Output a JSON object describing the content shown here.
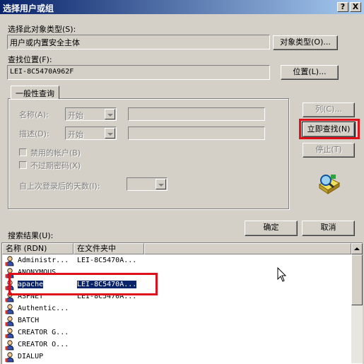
{
  "window": {
    "title": "选择用户或组",
    "help_btn": "?",
    "close_btn": "X"
  },
  "object_type": {
    "label": "选择此对象类型(S):",
    "value": "用户或内置安全主体",
    "button": "对象类型(O)..."
  },
  "location": {
    "label": "查找位置(F):",
    "value": "LEI-8C5470A962F",
    "button": "位置(L)..."
  },
  "general_query": {
    "tab": "一般性查询",
    "name_label": "名称(A):",
    "name_mode": "开始",
    "desc_label": "描述(D):",
    "desc_mode": "开始",
    "disabled_accounts": "禁用的帐户(B)",
    "non_expiring": "不过期密码(X)",
    "days_since_login": "自上次登录后的天数(I):"
  },
  "side_buttons": {
    "columns": "列(C)...",
    "find_now": "立即查找(N)",
    "stop": "停止(T)"
  },
  "dialog_buttons": {
    "ok": "确定",
    "cancel": "取消"
  },
  "results": {
    "label": "搜索结果(U):",
    "columns": [
      "名称 (RDN)",
      "在文件夹中"
    ],
    "rows": [
      {
        "name": "Administr...",
        "folder": "LEI-8C5470A..."
      },
      {
        "name": "ANONYMOUS ...",
        "folder": ""
      },
      {
        "name": "apache",
        "folder": "LEI-8C5470A..."
      },
      {
        "name": "ASPNET",
        "folder": "LEI-8C5470A..."
      },
      {
        "name": "Authentic...",
        "folder": ""
      },
      {
        "name": "BATCH",
        "folder": ""
      },
      {
        "name": "CREATOR G...",
        "folder": ""
      },
      {
        "name": "CREATOR O...",
        "folder": ""
      },
      {
        "name": "DIALUP",
        "folder": ""
      }
    ],
    "selected_index": 2
  },
  "colors": {
    "highlight": "#e0101a",
    "selection": "#0a246a",
    "face": "#d4d0c8"
  }
}
